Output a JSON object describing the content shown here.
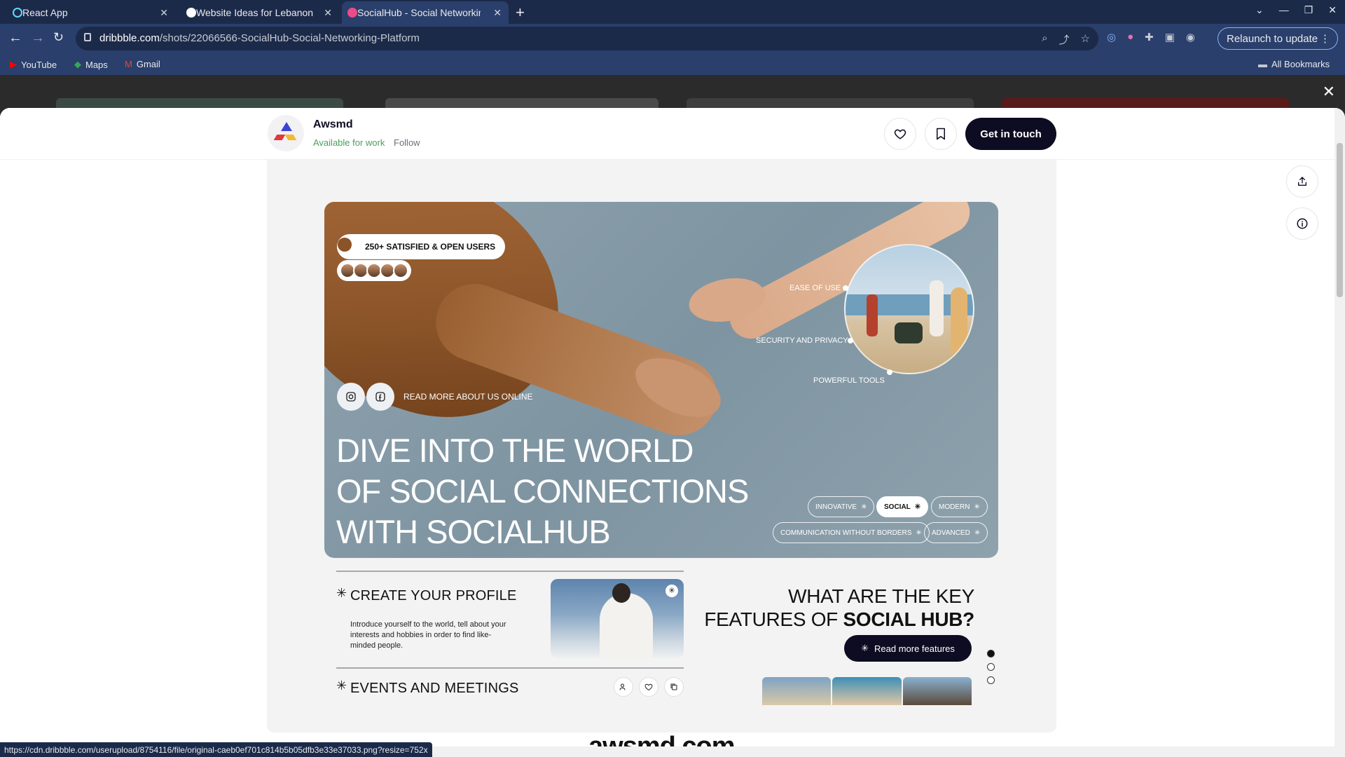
{
  "browser": {
    "tabs": [
      {
        "title": "React App"
      },
      {
        "title": "Website Ideas for Lebanon"
      },
      {
        "title": "SocialHub - Social Networkin"
      }
    ],
    "url_domain": "dribbble.com",
    "url_path": "/shots/22066566-SocialHub-Social-Networking-Platform",
    "relaunch_label": "Relaunch to update",
    "bookmarks": [
      "YouTube",
      "Maps",
      "Gmail"
    ],
    "all_bookmarks": "All Bookmarks",
    "status_url": "https://cdn.dribbble.com/userupload/8754116/file/original-caeb0ef701c814b5b05dfb3e33e37033.png?resize=752x"
  },
  "header": {
    "author": "Awsmd",
    "availability": "Available for work",
    "follow": "Follow",
    "cta": "Get in touch"
  },
  "hero": {
    "users_badge": "250+ SATISFIED & OPEN USERS",
    "ring_labels": [
      "EASE OF USE",
      "SECURITY AND PRIVACY",
      "POWERFUL TOOLS"
    ],
    "read_more_online": "READ MORE ABOUT US ONLINE",
    "title_lines": [
      "DIVE INTO THE WORLD",
      "OF SOCIAL CONNECTIONS",
      "WITH SOCIALHUB"
    ],
    "chips": [
      "INNOVATIVE",
      "SOCIAL",
      "MODERN",
      "COMMUNICATION WITHOUT BORDERS",
      "ADVANCED"
    ]
  },
  "features": {
    "items": [
      {
        "title": "CREATE YOUR PROFILE",
        "desc": "Introduce yourself to the world, tell about your interests and hobbies in order to find like-minded people."
      },
      {
        "title": "EVENTS AND MEETINGS"
      }
    ],
    "key_title_1": "WHAT ARE THE KEY",
    "key_title_2": "FEATURES OF ",
    "key_title_bold": "SOCIAL HUB?",
    "read_more_features": "Read more features"
  },
  "footer_heading": "awsmd.com"
}
